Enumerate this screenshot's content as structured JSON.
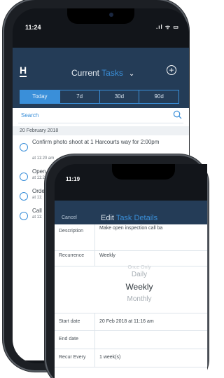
{
  "phone1": {
    "status_time": "11:24",
    "status_icons": ".ıl ᯤ ▭",
    "logo": "H",
    "header": {
      "title_plain": "Current ",
      "title_accent": "Tasks",
      "chevron": "❯",
      "add_icon": "+"
    },
    "tabs": [
      {
        "label": "Today",
        "active": true
      },
      {
        "label": "7d"
      },
      {
        "label": "30d"
      },
      {
        "label": "90d"
      }
    ],
    "search_placeholder": "Search",
    "date_group": "20 February 2018",
    "tasks": [
      {
        "title": "Confirm photo shoot at 1 Harcourts way for 2:00pm",
        "at": "at 11:20 am"
      },
      {
        "title": "Open in",
        "at": "at 11:2"
      },
      {
        "title": "Orde",
        "at": "at 11:"
      },
      {
        "title": "Call",
        "at": "at 11:"
      }
    ]
  },
  "phone2": {
    "status_time": "11:19",
    "cancel_label": "Cancel",
    "title_plain": "Edit ",
    "title_accent": "Task Details",
    "fields": {
      "description_label": "Description",
      "description_value": "Make open inspection call ba",
      "recurrence_label": "Recurrence",
      "recurrence_value": "Weekly",
      "start_label": "Start date",
      "start_value": "20 Feb 2018 at 11:16 am",
      "end_label": "End date",
      "end_value": "",
      "recur_every_label": "Recur Every",
      "recur_every_value": "1 week(s)"
    },
    "picker": {
      "above2": "Once Only",
      "above1": "Daily",
      "selected": "Weekly",
      "below1": "Monthly"
    }
  },
  "colors": {
    "header_bg": "#243c57",
    "accent": "#3a8fd9"
  }
}
